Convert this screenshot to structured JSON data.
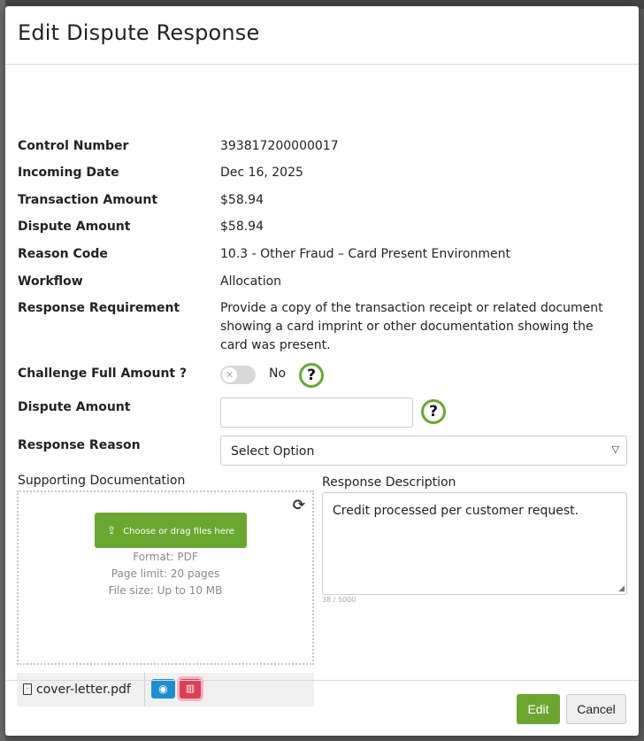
{
  "dialog": {
    "title": "Edit Dispute Response"
  },
  "details": [
    {
      "label": "Control Number",
      "value": "393817200000017"
    },
    {
      "label": "Incoming Date",
      "value": "Dec 16, 2025"
    },
    {
      "label": "Transaction Amount",
      "value": "$58.94"
    },
    {
      "label": "Dispute Amount",
      "value": "$58.94"
    },
    {
      "label": "Reason Code",
      "value": "10.3 - Other Fraud – Card Present Environment"
    },
    {
      "label": "Workflow",
      "value": "Allocation"
    },
    {
      "label": "Response Requirement",
      "value": "Provide a copy of the transaction receipt or related document showing a card imprint or other documentation showing the card was present."
    }
  ],
  "form": {
    "challenge_label": "Challenge Full Amount ?",
    "challenge_toggle_text": "No",
    "challenge_toggle_on": false,
    "dispute_amount_label": "Dispute Amount",
    "dispute_amount_value": "",
    "response_reason_label": "Response Reason",
    "response_reason_value": "Select Option",
    "help_glyph": "?"
  },
  "supporting_docs": {
    "label": "Supporting Documentation",
    "upload_button": "Choose or drag files here",
    "format": "Format: PDF",
    "page_limit": "Page limit: 20 pages",
    "file_size": "File size: Up to 10 MB",
    "files": [
      {
        "name": "cover-letter.pdf"
      }
    ]
  },
  "response_description": {
    "label": "Response Description",
    "value": "Credit processed per customer request.",
    "char_count": "38 / 5000"
  },
  "footer": {
    "edit_label": "Edit",
    "cancel_label": "Cancel"
  },
  "icons": {
    "help": "question-circle-icon",
    "refresh": "refresh-icon",
    "upload": "upload-icon",
    "file": "file-pdf-icon",
    "view": "eye-icon",
    "delete": "trash-icon",
    "caret": "caret-down-icon"
  },
  "colors": {
    "primary_green": "#6aa72e",
    "view_blue": "#1b8fd4",
    "delete_red": "#dc3e55"
  }
}
